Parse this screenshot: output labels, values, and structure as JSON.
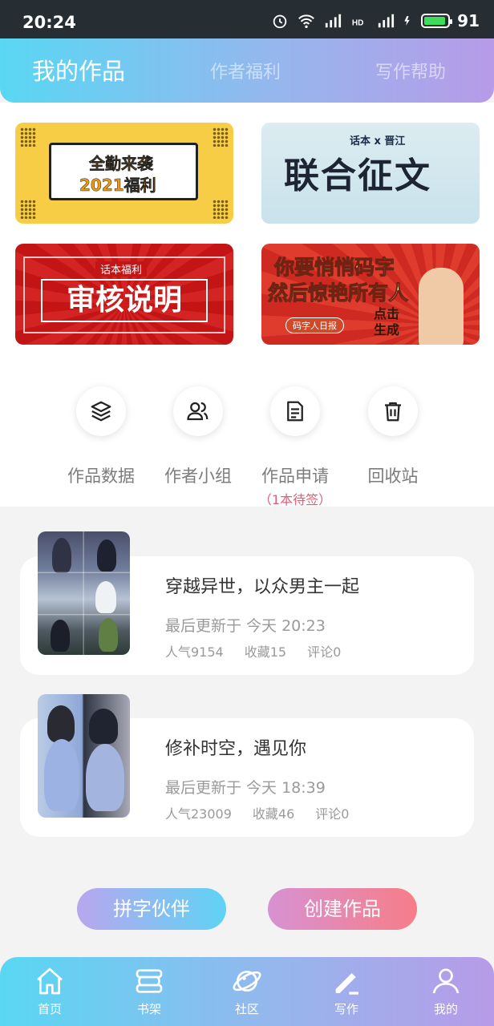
{
  "status_bar": {
    "time": "20:24",
    "battery": "91"
  },
  "header": {
    "tabs": [
      {
        "label": "我的作品",
        "active": true
      },
      {
        "label": "作者福利",
        "active": false
      },
      {
        "label": "写作帮助",
        "active": false
      }
    ]
  },
  "banners": {
    "attendance": {
      "line1": "全勤来袭",
      "line2": "2021福利"
    },
    "contest": {
      "subtitle": "话本 x 晋江",
      "title": "联合征文"
    },
    "review": {
      "tag": "话本福利",
      "title": "审核说明"
    },
    "typing": {
      "line1": "你要悄悄码字",
      "line2": "然后惊艳所有人",
      "badge": "码字人日报",
      "cta": "点击生成"
    }
  },
  "actions": [
    {
      "label": "作品数据",
      "icon": "layers-icon"
    },
    {
      "label": "作者小组",
      "icon": "group-icon"
    },
    {
      "label": "作品申请",
      "icon": "document-icon",
      "note": "（1本待签）"
    },
    {
      "label": "回收站",
      "icon": "trash-icon"
    }
  ],
  "works": [
    {
      "title": "穿越异世，以众男主一起",
      "updated": "最后更新于 今天 20:23",
      "popularity": "人气9154",
      "favorites": "收藏15",
      "comments": "评论0"
    },
    {
      "title": "修补时空，遇见你",
      "updated": "最后更新于 今天 18:39",
      "popularity": "人气23009",
      "favorites": "收藏46",
      "comments": "评论0"
    }
  ],
  "buttons": {
    "partner": "拼字伙伴",
    "create": "创建作品"
  },
  "nav": [
    {
      "label": "首页",
      "icon": "home-icon"
    },
    {
      "label": "书架",
      "icon": "bookshelf-icon"
    },
    {
      "label": "社区",
      "icon": "planet-icon"
    },
    {
      "label": "写作",
      "icon": "pen-icon",
      "active": true
    },
    {
      "label": "我的",
      "icon": "user-icon"
    }
  ],
  "colors": {
    "gradient_start": "#59d7f3",
    "gradient_end": "#b79be8",
    "accent_pink": "#e0607a"
  }
}
